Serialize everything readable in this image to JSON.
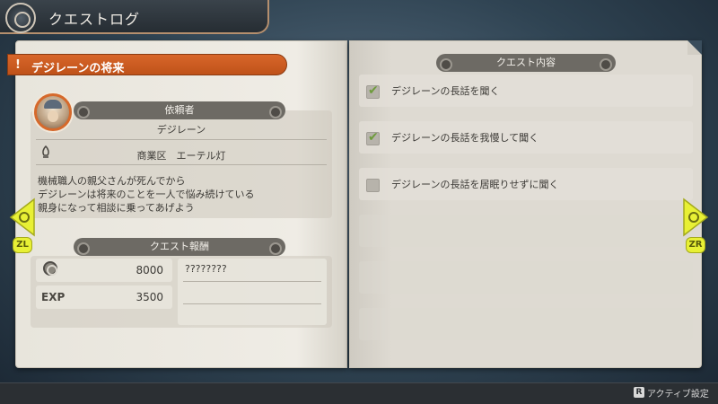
{
  "header": {
    "title": "クエストログ",
    "emblem_icon": "ring-emblem-icon"
  },
  "quest": {
    "mark": "!",
    "title": "デジレーンの将来"
  },
  "client": {
    "section_label": "依頼者",
    "name": "デジレーン",
    "district": "商業区　エーテル灯",
    "description": [
      "機械職人の親父さんが死んでから",
      "デジレーンは将来のことを一人で悩み続けている",
      "親身になって相談に乗ってあげよう"
    ]
  },
  "reward": {
    "section_label": "クエスト報酬",
    "money": "8000",
    "exp_label": "EXP",
    "exp": "3500",
    "item": "????????"
  },
  "objectives": {
    "section_label": "クエスト内容",
    "items": [
      {
        "text": "デジレーンの長話を聞く",
        "done": true
      },
      {
        "text": "デジレーンの長話を我慢して聞く",
        "done": true
      },
      {
        "text": "デジレーンの長話を居眠りせずに聞く",
        "done": false
      }
    ]
  },
  "nav": {
    "left_button": "ZL",
    "right_button": "ZR"
  },
  "footer": {
    "key": "R",
    "label": "アクティブ設定"
  },
  "colors": {
    "accent": "#c85a1e",
    "nav": "#e8f035",
    "check": "#6e9b3c"
  }
}
